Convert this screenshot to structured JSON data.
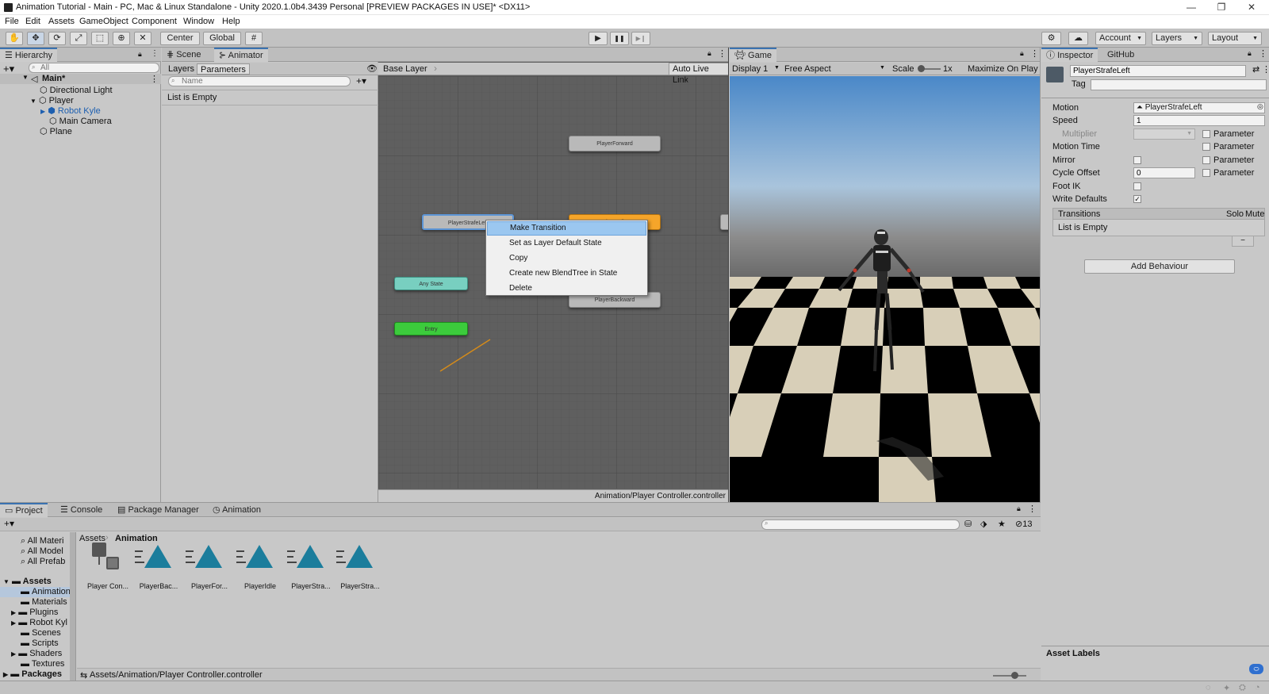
{
  "window": {
    "title": "Animation Tutorial - Main - PC, Mac & Linux Standalone - Unity 2020.1.0b4.3439 Personal [PREVIEW PACKAGES IN USE]* <DX11>",
    "controls": [
      "—",
      "❐",
      "✕"
    ]
  },
  "menu": [
    "File",
    "Edit",
    "Assets",
    "GameObject",
    "Component",
    "Window",
    "Help"
  ],
  "toolbar": {
    "pivot": "Center",
    "space": "Global",
    "play": "▶",
    "pause": "❚❚",
    "step": "▶❙",
    "account": "Account",
    "layers": "Layers",
    "layout": "Layout"
  },
  "hierarchy": {
    "tab": "Hierarchy",
    "search_placeholder": "All",
    "scene": "Main*",
    "items": [
      "Directional Light",
      "Player",
      "Robot Kyle",
      "Main Camera",
      "Plane"
    ]
  },
  "animator_panel": {
    "tabs": [
      "Scene",
      "Animator"
    ],
    "subtabs": [
      "Layers",
      "Parameters"
    ],
    "name_placeholder": "Name",
    "list_empty": "List is Empty",
    "breadcrumb": "Base Layer",
    "auto_live_link": "Auto Live Link",
    "status_path": "Animation/Player Controller.controller",
    "states": [
      "PlayerForward",
      "PlayerStrafeLeft",
      "PlayerIdle",
      "PlayerBackward",
      "Any State",
      "Entry"
    ]
  },
  "context_menu": {
    "items": [
      "Make Transition",
      "Set as Layer Default State",
      "Copy",
      "Create new BlendTree in State",
      "Delete"
    ]
  },
  "game": {
    "tab": "Game",
    "display": "Display 1",
    "aspect": "Free Aspect",
    "scale_label": "Scale",
    "scale_value": "1x",
    "maximize": "Maximize On Play"
  },
  "inspector": {
    "tabs": [
      "Inspector",
      "GitHub"
    ],
    "object_name": "PlayerStrafeLeft",
    "tag_label": "Tag",
    "motion_label": "Motion",
    "motion_value": "PlayerStrafeLeft",
    "speed_label": "Speed",
    "speed_value": "1",
    "multiplier_label": "Multiplier",
    "parameter_label": "Parameter",
    "motion_time_label": "Motion Time",
    "mirror_label": "Mirror",
    "cycle_offset_label": "Cycle Offset",
    "cycle_offset_value": "0",
    "foot_ik_label": "Foot IK",
    "write_defaults_label": "Write Defaults",
    "write_defaults_checked": true,
    "transitions_header": "Transitions",
    "solo": "Solo",
    "mute": "Mute",
    "transitions_empty": "List is Empty",
    "add_behaviour": "Add Behaviour",
    "asset_labels": "Asset Labels"
  },
  "project": {
    "tabs": [
      "Project",
      "Console",
      "Package Manager",
      "Animation"
    ],
    "favorites": [
      "All Materi",
      "All Model",
      "All Prefab"
    ],
    "tree": [
      "Assets",
      "Animation",
      "Materials",
      "Plugins",
      "Robot Kyl",
      "Scenes",
      "Scripts",
      "Shaders",
      "Textures",
      "Packages"
    ],
    "breadcrumb_root": "Assets",
    "breadcrumb_current": "Animation",
    "hidden_count": "13",
    "assets": [
      "Player Con...",
      "PlayerBac...",
      "PlayerFor...",
      "PlayerIdle",
      "PlayerStra...",
      "PlayerStra..."
    ],
    "footer_path": "Assets/Animation/Player Controller.controller"
  }
}
